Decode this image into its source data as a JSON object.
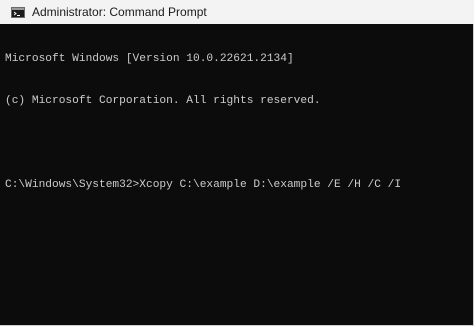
{
  "window": {
    "title": "Administrator: Command Prompt",
    "icon": "cmd-terminal-icon"
  },
  "console": {
    "lines": [
      "Microsoft Windows [Version 10.0.22621.2134]",
      "(c) Microsoft Corporation. All rights reserved.",
      "",
      "C:\\Windows\\System32>Xcopy C:\\example D:\\example /E /H /C /I"
    ]
  },
  "colors": {
    "console_background": "#0c0c0c",
    "console_text": "#cccccc",
    "titlebar_background": "#f3f3f3"
  }
}
